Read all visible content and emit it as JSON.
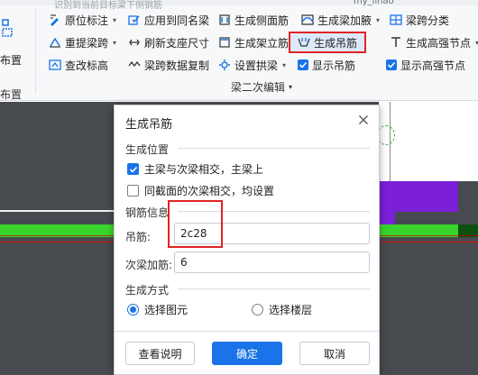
{
  "ribbon": {
    "top_hint": "识别到当前目标梁下侧钢筋",
    "user": "my_linao",
    "left": {
      "label1": "布置",
      "label2": "布置"
    },
    "row1": [
      {
        "label": "原位标注",
        "icon": "annotate-icon",
        "caret": "▾"
      },
      {
        "label": "应用到同名梁",
        "icon": "apply-same-beam-icon"
      },
      {
        "label": "生成侧面筋",
        "icon": "side-rebar-icon"
      },
      {
        "label": "生成梁加腋",
        "icon": "haunch-icon",
        "caret": "▾"
      },
      {
        "label": "梁跨分类",
        "icon": "span-classify-icon"
      }
    ],
    "row2": [
      {
        "label": "重提梁跨",
        "icon": "reextract-span-icon",
        "caret": "▾"
      },
      {
        "label": "刷新支座尺寸",
        "icon": "refresh-support-icon"
      },
      {
        "label": "生成架立筋",
        "icon": "erection-rebar-icon"
      },
      {
        "label": "生成吊筋",
        "icon": "hanger-rebar-icon"
      },
      {
        "label": "生成高强节点",
        "icon": "high-strength-joint-icon",
        "caret": "▾"
      }
    ],
    "row3": [
      {
        "label": "查改标高",
        "icon": "elevation-icon"
      },
      {
        "label": "梁跨数据复制",
        "icon": "span-copy-icon"
      },
      {
        "label": "设置拱梁",
        "icon": "arch-beam-icon",
        "caret": "▾"
      },
      {
        "label": "显示吊筋",
        "checked": true
      },
      {
        "label": "显示高强节点",
        "checked": true
      }
    ],
    "group_label": "梁二次编辑",
    "group_caret": "▾"
  },
  "dialog": {
    "title": "生成吊筋",
    "section_position": "生成位置",
    "opt1": "主梁与次梁相交，主梁上",
    "opt1_checked": true,
    "opt2": "同截面的次梁相交，均设置",
    "opt2_checked": false,
    "section_rebar": "钢筋信息",
    "hanger_label": "吊筋:",
    "hanger_value": "2c28",
    "secondary_label": "次梁加筋:",
    "secondary_value": "6",
    "section_method": "生成方式",
    "radio1": "选择图元",
    "radio2": "选择楼层",
    "radio_selected": "选择图元",
    "btn_help": "查看说明",
    "btn_ok": "确定",
    "btn_cancel": "取消"
  },
  "colors": {
    "accent": "#1a73e8",
    "highlight_red": "#e02424",
    "beam_green": "#39d42b",
    "beam_purple": "#7b1fd8",
    "canvas": "#474a4f"
  }
}
